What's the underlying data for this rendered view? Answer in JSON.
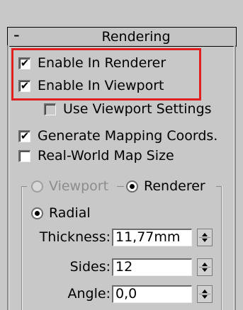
{
  "rollout": {
    "collapse": "-",
    "title": "Rendering"
  },
  "checks": {
    "enable_renderer": {
      "label": "Enable In Renderer",
      "checked": true
    },
    "enable_viewport": {
      "label": "Enable In Viewport",
      "checked": true
    },
    "use_viewport_settings": {
      "label": "Use Viewport Settings",
      "checked": false
    },
    "generate_mapping": {
      "label": "Generate Mapping Coords.",
      "checked": true
    },
    "real_world": {
      "label": "Real-World Map Size",
      "checked": false
    }
  },
  "mode": {
    "viewport_label": "Viewport",
    "renderer_label": "Renderer",
    "selected": "Renderer"
  },
  "radial": {
    "label": "Radial",
    "selected": true
  },
  "params": {
    "thickness": {
      "label": "Thickness:",
      "value": "11,77mm"
    },
    "sides": {
      "label": "Sides:",
      "value": "12"
    },
    "angle": {
      "label": "Angle:",
      "value": "0,0"
    }
  },
  "colors": {
    "highlight": "#e02020",
    "panel": "#c8c8c8"
  },
  "icons": {
    "check": "checkmark-icon",
    "spin": "spinner-arrows-icon"
  }
}
